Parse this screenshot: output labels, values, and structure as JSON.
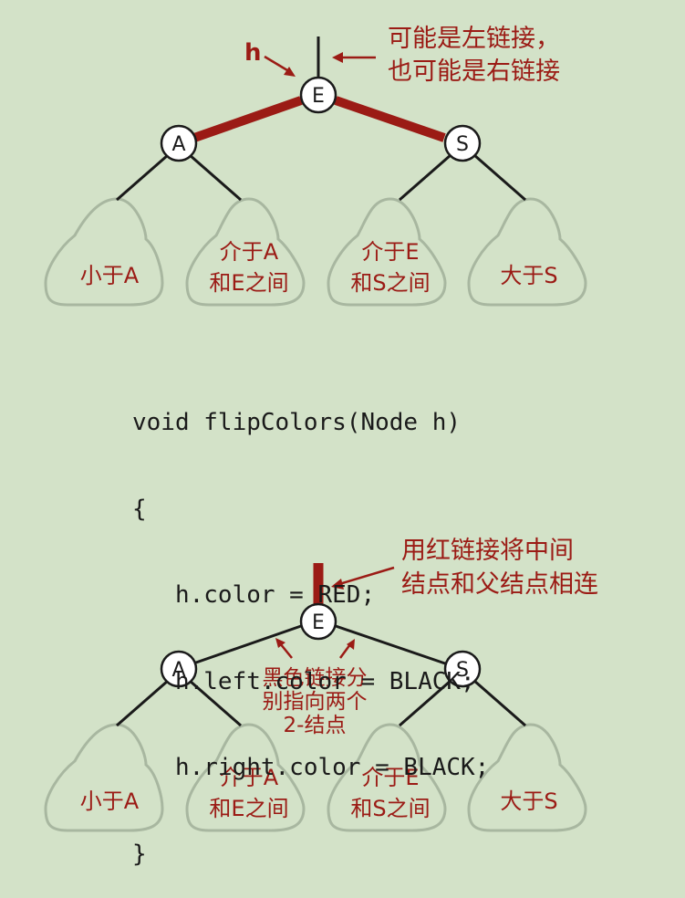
{
  "top": {
    "h_label": "h",
    "note_line1": "可能是左链接，",
    "note_line2": "也可能是右链接",
    "nodes": {
      "left": "A",
      "center": "E",
      "right": "S"
    },
    "subtrees": {
      "s1": [
        "小于A"
      ],
      "s2": [
        "介于A",
        "和E之间"
      ],
      "s3": [
        "介于E",
        "和S之间"
      ],
      "s4": [
        "大于S"
      ]
    }
  },
  "code": {
    "lines": [
      "void flipColors(Node h)",
      "{",
      "   h.color = RED;",
      "   h.left.color = BLACK;",
      "   h.right.color = BLACK;",
      "}"
    ]
  },
  "bottom": {
    "note_line1": "用红链接将中间",
    "note_line2": "结点和父结点相连",
    "inner_line1": "黑色链接分",
    "inner_line2": "别指向两个",
    "inner_line3": "2-结点",
    "nodes": {
      "left": "A",
      "center": "E",
      "right": "S"
    },
    "subtrees": {
      "s1": [
        "小于A"
      ],
      "s2": [
        "介于A",
        "和E之间"
      ],
      "s3": [
        "介于E",
        "和S之间"
      ],
      "s4": [
        "大于S"
      ]
    }
  },
  "colors": {
    "background": "#d3e2c8",
    "red_link": "#9b1b15",
    "black_link": "#1a1a1a",
    "subtree_outline": "#a8b7a0"
  }
}
